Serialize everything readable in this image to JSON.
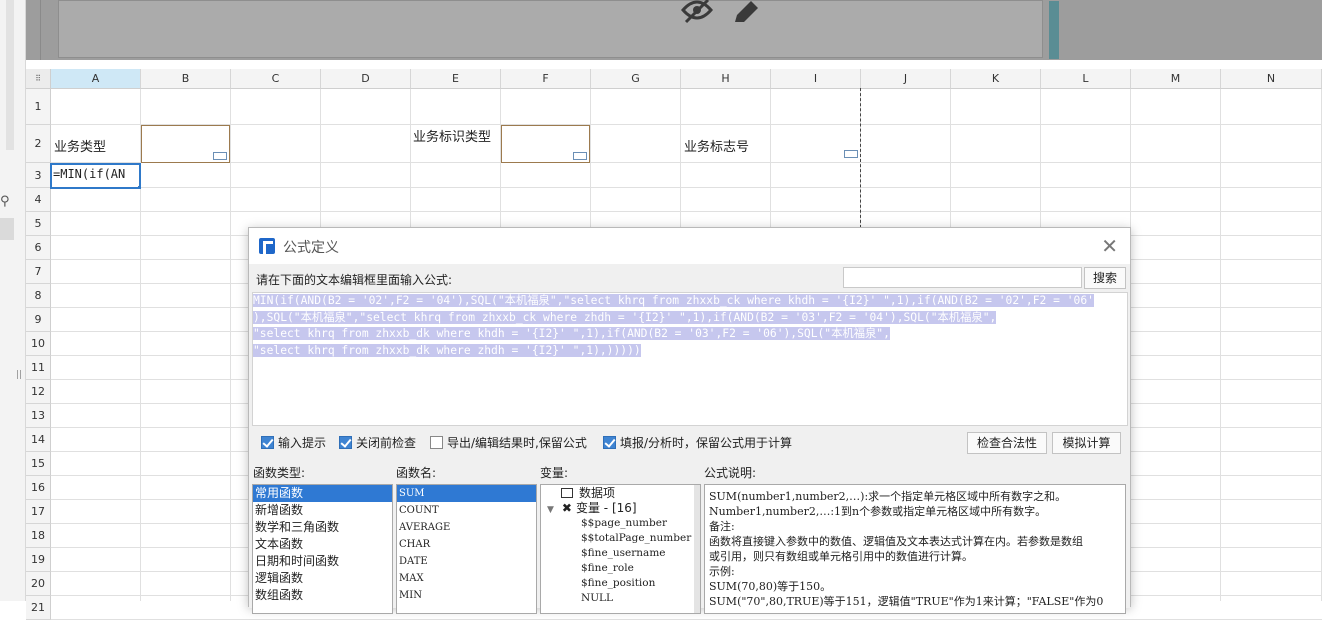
{
  "columns": [
    "A",
    "B",
    "C",
    "D",
    "E",
    "F",
    "G",
    "H",
    "I",
    "J",
    "K",
    "L",
    "M",
    "N"
  ],
  "rows": [
    "1",
    "2",
    "3",
    "4",
    "5",
    "6",
    "7",
    "8",
    "9",
    "10",
    "11",
    "12",
    "13",
    "14",
    "15",
    "16",
    "17",
    "18",
    "19",
    "20",
    "21"
  ],
  "cells": {
    "A2": "业务类型",
    "E2": "业务标识类型",
    "H2": "业务标志号",
    "A3": "=MIN(if(AN"
  },
  "dialog": {
    "title": "公式定义",
    "close": "✕",
    "prompt": "请在下面的文本编辑框里面输入公式:",
    "search_button": "搜索",
    "search_value": "",
    "formula_lines": [
      "MIN(if(AND(B2 = '02',F2 = '04'),SQL(\"本机福泉\",\"select khrq from zhxxb_ck where khdh = '{I2}' \",1),if(AND(B2 = '02',F2 = '06'",
      "),SQL(\"本机福泉\",\"select khrq from zhxxb_ck where zhdh = '{I2}' \",1),if(AND(B2 = '03',F2 = '04'),SQL(\"本机福泉\",",
      "\"select khrq from zhxxb_dk where khdh = '{I2}' \",1),if(AND(B2 = '03',F2 = '06'),SQL(\"本机福泉\",",
      "\"select khrq from zhxxb_dk where zhdh = '{I2}' \",1),)))))"
    ],
    "options": [
      {
        "label": "输入提示",
        "checked": true
      },
      {
        "label": "关闭前检查",
        "checked": true
      },
      {
        "label": "导出/编辑结果时,保留公式",
        "checked": false
      },
      {
        "label": "填报/分析时，保留公式用于计算",
        "checked": true
      }
    ],
    "check_button": "检查合法性",
    "simulate_button": "模拟计算",
    "func_type_label": "函数类型:",
    "func_types": [
      "常用函数",
      "新增函数",
      "数学和三角函数",
      "文本函数",
      "日期和时间函数",
      "逻辑函数",
      "数组函数"
    ],
    "func_name_label": "函数名:",
    "func_names": [
      "SUM",
      "COUNT",
      "AVERAGE",
      "CHAR",
      "DATE",
      "MAX",
      "MIN"
    ],
    "var_label": "变量:",
    "var_tree": {
      "root": "数据项",
      "group": "变量 - [16]",
      "items": [
        "$$page_number",
        "$$totalPage_number",
        "$fine_username",
        "$fine_role",
        "$fine_position",
        "NULL"
      ]
    },
    "desc_label": "公式说明:",
    "desc_lines": [
      "SUM(number1,number2,…):求一个指定单元格区域中所有数字之和。",
      "Number1,number2,…:1到n个参数或指定单元格区域中所有数字。",
      "备注:",
      "函数将直接键入参数中的数值、逻辑值及文本表达式计算在内。若参数是数组",
      "或引用，则只有数组或单元格引用中的数值进行计算。",
      "示例:",
      "SUM(70,80)等于150。",
      "SUM(\"70\",80,TRUE)等于151，逻辑值\"TRUE\"作为1来计算；\"FALSE\"作为0"
    ]
  },
  "colors": {
    "accent": "#2f79d3",
    "selection": "#c6c7ee",
    "top_panel": "#9d9d9d"
  }
}
